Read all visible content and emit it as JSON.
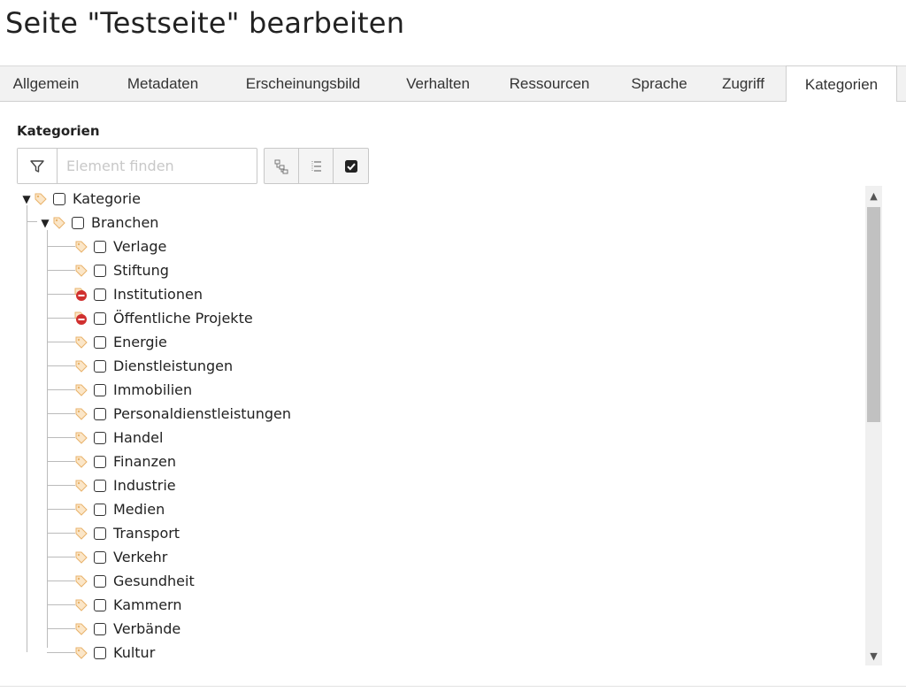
{
  "page": {
    "title": "Seite \"Testseite\" bearbeiten"
  },
  "tabs": [
    {
      "label": "Allgemein",
      "active": false
    },
    {
      "label": "Metadaten",
      "active": false
    },
    {
      "label": "Erscheinungsbild",
      "active": false
    },
    {
      "label": "Verhalten",
      "active": false
    },
    {
      "label": "Ressourcen",
      "active": false
    },
    {
      "label": "Sprache",
      "active": false
    },
    {
      "label": "Zugriff",
      "active": false
    },
    {
      "label": "Kategorien",
      "active": true
    }
  ],
  "categories": {
    "label": "Kategorien",
    "filter_placeholder": "Element finden",
    "filter_value": "",
    "toolbar": [
      {
        "icon": "tree-expand-icon"
      },
      {
        "icon": "list-collapse-icon"
      },
      {
        "icon": "checked-only-icon"
      }
    ],
    "tree": {
      "root": {
        "label": "Kategorie",
        "expanded": true,
        "checked": false,
        "icon": "category-icon"
      },
      "group": {
        "label": "Branchen",
        "expanded": true,
        "checked": false,
        "icon": "category-icon"
      },
      "items": [
        {
          "label": "Verlage",
          "icon": "category-icon",
          "checked": false
        },
        {
          "label": "Stiftung",
          "icon": "category-icon",
          "checked": false
        },
        {
          "label": "Institutionen",
          "icon": "category-hidden-icon",
          "checked": false
        },
        {
          "label": "Öffentliche Projekte",
          "icon": "category-hidden-icon",
          "checked": false
        },
        {
          "label": "Energie",
          "icon": "category-icon",
          "checked": false
        },
        {
          "label": "Dienstleistungen",
          "icon": "category-icon",
          "checked": false
        },
        {
          "label": "Immobilien",
          "icon": "category-icon",
          "checked": false
        },
        {
          "label": "Personaldienstleistungen",
          "icon": "category-icon",
          "checked": false
        },
        {
          "label": "Handel",
          "icon": "category-icon",
          "checked": false
        },
        {
          "label": "Finanzen",
          "icon": "category-icon",
          "checked": false
        },
        {
          "label": "Industrie",
          "icon": "category-icon",
          "checked": false
        },
        {
          "label": "Medien",
          "icon": "category-icon",
          "checked": false
        },
        {
          "label": "Transport",
          "icon": "category-icon",
          "checked": false
        },
        {
          "label": "Verkehr",
          "icon": "category-icon",
          "checked": false
        },
        {
          "label": "Gesundheit",
          "icon": "category-icon",
          "checked": false
        },
        {
          "label": "Kammern",
          "icon": "category-icon",
          "checked": false
        },
        {
          "label": "Verbände",
          "icon": "category-icon",
          "checked": false
        },
        {
          "label": "Kultur",
          "icon": "category-icon",
          "checked": false
        }
      ]
    }
  },
  "colors": {
    "tab_bar": "#f2f2f2",
    "hidden_icon": "#d0302f",
    "tag_icon": "#f0b060"
  }
}
